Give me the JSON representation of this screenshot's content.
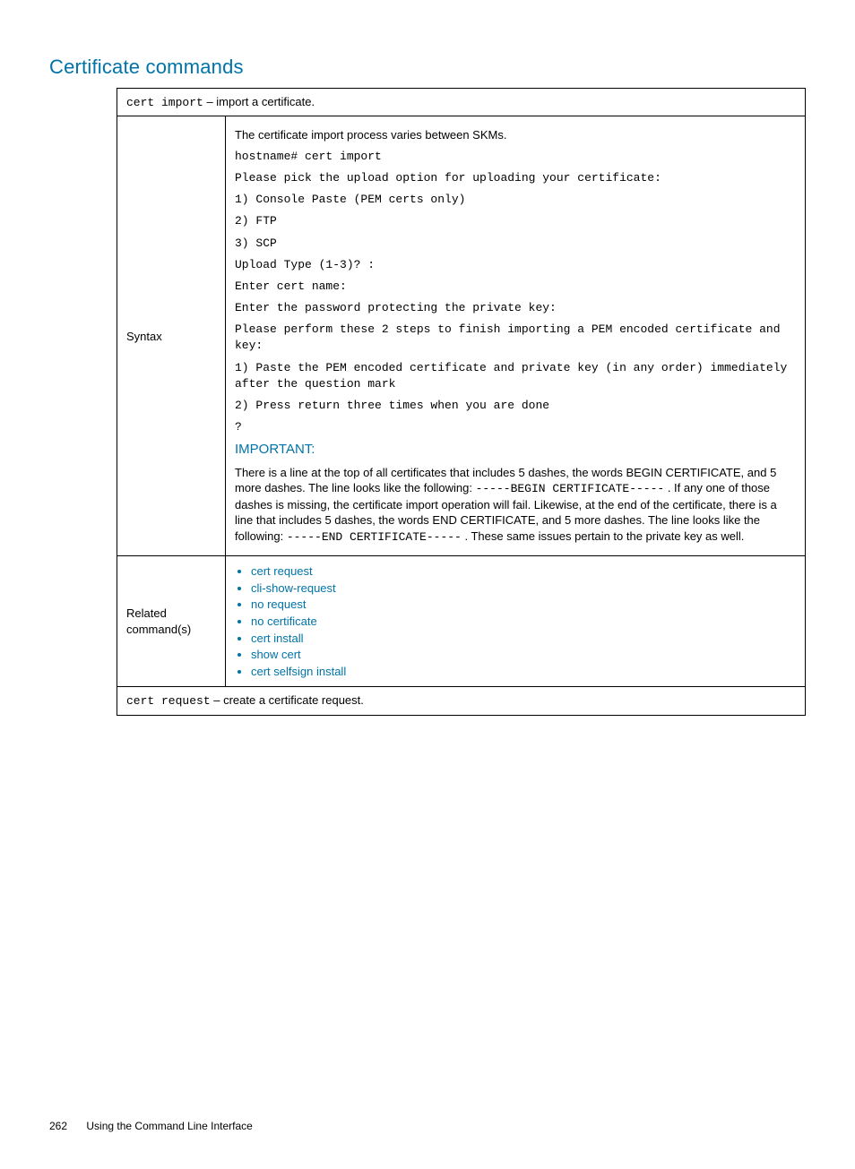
{
  "section_title": "Certificate commands",
  "cmd1": {
    "name": "cert import",
    "desc": " – import a certificate.",
    "intro": "The certificate import process varies between SKMs.",
    "lines": [
      "hostname# cert import",
      "Please pick the upload option for uploading your certificate:",
      "1) Console Paste (PEM certs only)",
      "2) FTP",
      "3) SCP",
      "Upload Type (1-3)?  :",
      "Enter cert name:",
      "Enter the password protecting the private key:",
      "Please perform these 2 steps to finish importing a PEM encoded certificate and key:",
      "1) Paste the PEM encoded certificate and private key (in any order) immediately after the question mark",
      "2) Press return three times when you are done",
      "?"
    ],
    "important_label": "IMPORTANT:",
    "important_pre": "There is a line at the top of all certificates that includes 5 dashes, the words BEGIN CERTIFICATE, and 5 more dashes. The line looks like the following: ",
    "important_code1": "-----BEGIN CERTIFICATE-----",
    "important_mid": " . If any one of those dashes is missing, the certificate import operation will fail. Likewise, at the end of the certificate, there is a line that includes 5 dashes, the words END CERTIFICATE, and 5 more dashes. The line looks like the following: ",
    "important_code2": "-----END CERTIFICATE-----",
    "important_post": " . These same issues pertain to the private key as well.",
    "syntax_label": "Syntax",
    "related_label": "Related command(s)",
    "related": [
      "cert request",
      "cli-show-request",
      "no request",
      "no certificate",
      "cert install",
      "show cert",
      "cert selfsign install"
    ]
  },
  "cmd2": {
    "name": "cert request",
    "desc": " – create a certificate request."
  },
  "footer": {
    "page": "262",
    "title": "Using the Command Line Interface"
  }
}
